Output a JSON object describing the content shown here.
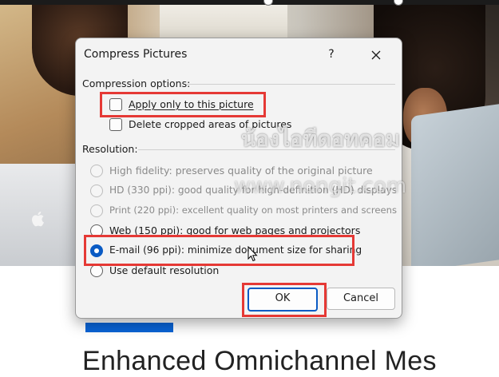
{
  "dialog": {
    "title": "Compress Pictures",
    "help": "?",
    "compression_section": "Compression options:",
    "checkboxes": [
      {
        "label": "Apply only to this picture",
        "checked": false
      },
      {
        "label": "Delete cropped areas of pictures",
        "checked": false
      }
    ],
    "resolution_section": "Resolution:",
    "radios": [
      {
        "label": "High fidelity: preserves quality of the original picture",
        "enabled": false,
        "selected": false
      },
      {
        "label": "HD (330 ppi): good quality for high-definition (HD) displays",
        "enabled": false,
        "selected": false
      },
      {
        "label": "Print (220 ppi): excellent quality on most printers and screens",
        "enabled": false,
        "selected": false
      },
      {
        "label": "Web (150 ppi): good for web pages and projectors",
        "enabled": true,
        "selected": false
      },
      {
        "label": "E-mail (96 ppi): minimize document size for sharing",
        "enabled": true,
        "selected": true
      },
      {
        "label": "Use default resolution",
        "enabled": true,
        "selected": false
      }
    ],
    "ok_label": "OK",
    "cancel_label": "Cancel"
  },
  "watermark": {
    "thai": "น้องไอทีดอทคอม",
    "url": "www.nongit.com"
  },
  "document": {
    "heading": "Enhanced Omnichannel Mes"
  },
  "colors": {
    "accent": "#0a5bc4",
    "annotation": "#e53935",
    "doc_bar": "#0a64d6"
  }
}
